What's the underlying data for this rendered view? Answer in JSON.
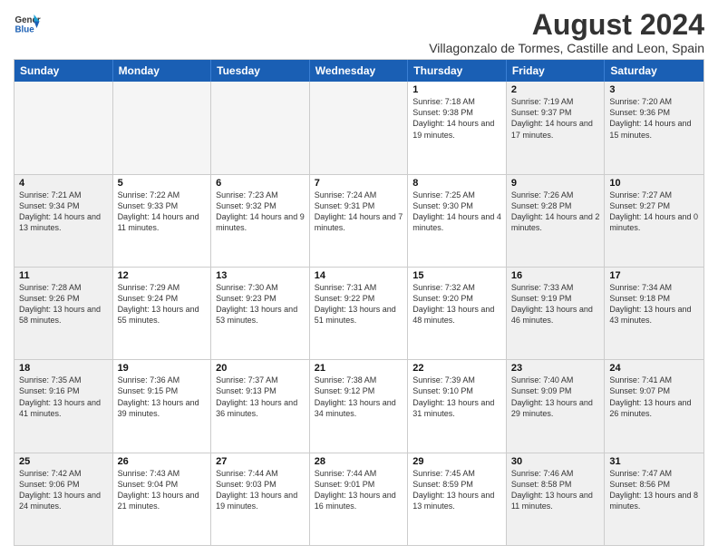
{
  "header": {
    "logo_line1": "General",
    "logo_line2": "Blue",
    "main_title": "August 2024",
    "subtitle": "Villagonzalo de Tormes, Castille and Leon, Spain"
  },
  "weekdays": [
    "Sunday",
    "Monday",
    "Tuesday",
    "Wednesday",
    "Thursday",
    "Friday",
    "Saturday"
  ],
  "rows": [
    [
      {
        "day": "",
        "info": "",
        "empty": true,
        "weekend": true
      },
      {
        "day": "",
        "info": "",
        "empty": true
      },
      {
        "day": "",
        "info": "",
        "empty": true
      },
      {
        "day": "",
        "info": "",
        "empty": true
      },
      {
        "day": "1",
        "info": "Sunrise: 7:18 AM\nSunset: 9:38 PM\nDaylight: 14 hours and 19 minutes."
      },
      {
        "day": "2",
        "info": "Sunrise: 7:19 AM\nSunset: 9:37 PM\nDaylight: 14 hours and 17 minutes.",
        "weekend": true
      },
      {
        "day": "3",
        "info": "Sunrise: 7:20 AM\nSunset: 9:36 PM\nDaylight: 14 hours and 15 minutes.",
        "weekend": true
      }
    ],
    [
      {
        "day": "4",
        "info": "Sunrise: 7:21 AM\nSunset: 9:34 PM\nDaylight: 14 hours and 13 minutes.",
        "weekend": true
      },
      {
        "day": "5",
        "info": "Sunrise: 7:22 AM\nSunset: 9:33 PM\nDaylight: 14 hours and 11 minutes."
      },
      {
        "day": "6",
        "info": "Sunrise: 7:23 AM\nSunset: 9:32 PM\nDaylight: 14 hours and 9 minutes."
      },
      {
        "day": "7",
        "info": "Sunrise: 7:24 AM\nSunset: 9:31 PM\nDaylight: 14 hours and 7 minutes."
      },
      {
        "day": "8",
        "info": "Sunrise: 7:25 AM\nSunset: 9:30 PM\nDaylight: 14 hours and 4 minutes."
      },
      {
        "day": "9",
        "info": "Sunrise: 7:26 AM\nSunset: 9:28 PM\nDaylight: 14 hours and 2 minutes.",
        "weekend": true
      },
      {
        "day": "10",
        "info": "Sunrise: 7:27 AM\nSunset: 9:27 PM\nDaylight: 14 hours and 0 minutes.",
        "weekend": true
      }
    ],
    [
      {
        "day": "11",
        "info": "Sunrise: 7:28 AM\nSunset: 9:26 PM\nDaylight: 13 hours and 58 minutes.",
        "weekend": true
      },
      {
        "day": "12",
        "info": "Sunrise: 7:29 AM\nSunset: 9:24 PM\nDaylight: 13 hours and 55 minutes."
      },
      {
        "day": "13",
        "info": "Sunrise: 7:30 AM\nSunset: 9:23 PM\nDaylight: 13 hours and 53 minutes."
      },
      {
        "day": "14",
        "info": "Sunrise: 7:31 AM\nSunset: 9:22 PM\nDaylight: 13 hours and 51 minutes."
      },
      {
        "day": "15",
        "info": "Sunrise: 7:32 AM\nSunset: 9:20 PM\nDaylight: 13 hours and 48 minutes."
      },
      {
        "day": "16",
        "info": "Sunrise: 7:33 AM\nSunset: 9:19 PM\nDaylight: 13 hours and 46 minutes.",
        "weekend": true
      },
      {
        "day": "17",
        "info": "Sunrise: 7:34 AM\nSunset: 9:18 PM\nDaylight: 13 hours and 43 minutes.",
        "weekend": true
      }
    ],
    [
      {
        "day": "18",
        "info": "Sunrise: 7:35 AM\nSunset: 9:16 PM\nDaylight: 13 hours and 41 minutes.",
        "weekend": true
      },
      {
        "day": "19",
        "info": "Sunrise: 7:36 AM\nSunset: 9:15 PM\nDaylight: 13 hours and 39 minutes."
      },
      {
        "day": "20",
        "info": "Sunrise: 7:37 AM\nSunset: 9:13 PM\nDaylight: 13 hours and 36 minutes."
      },
      {
        "day": "21",
        "info": "Sunrise: 7:38 AM\nSunset: 9:12 PM\nDaylight: 13 hours and 34 minutes."
      },
      {
        "day": "22",
        "info": "Sunrise: 7:39 AM\nSunset: 9:10 PM\nDaylight: 13 hours and 31 minutes."
      },
      {
        "day": "23",
        "info": "Sunrise: 7:40 AM\nSunset: 9:09 PM\nDaylight: 13 hours and 29 minutes.",
        "weekend": true
      },
      {
        "day": "24",
        "info": "Sunrise: 7:41 AM\nSunset: 9:07 PM\nDaylight: 13 hours and 26 minutes.",
        "weekend": true
      }
    ],
    [
      {
        "day": "25",
        "info": "Sunrise: 7:42 AM\nSunset: 9:06 PM\nDaylight: 13 hours and 24 minutes.",
        "weekend": true
      },
      {
        "day": "26",
        "info": "Sunrise: 7:43 AM\nSunset: 9:04 PM\nDaylight: 13 hours and 21 minutes."
      },
      {
        "day": "27",
        "info": "Sunrise: 7:44 AM\nSunset: 9:03 PM\nDaylight: 13 hours and 19 minutes."
      },
      {
        "day": "28",
        "info": "Sunrise: 7:44 AM\nSunset: 9:01 PM\nDaylight: 13 hours and 16 minutes."
      },
      {
        "day": "29",
        "info": "Sunrise: 7:45 AM\nSunset: 8:59 PM\nDaylight: 13 hours and 13 minutes."
      },
      {
        "day": "30",
        "info": "Sunrise: 7:46 AM\nSunset: 8:58 PM\nDaylight: 13 hours and 11 minutes.",
        "weekend": true
      },
      {
        "day": "31",
        "info": "Sunrise: 7:47 AM\nSunset: 8:56 PM\nDaylight: 13 hours and 8 minutes.",
        "weekend": true
      }
    ]
  ]
}
